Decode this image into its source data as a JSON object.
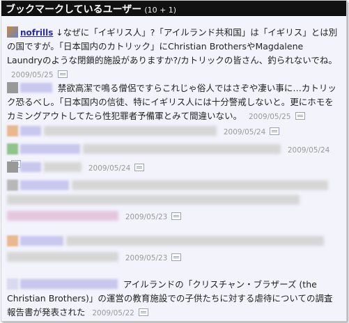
{
  "header": {
    "title": "ブックマークしているユーザー",
    "count": "(10 + 1)"
  },
  "entries": [
    {
      "user": "nofrills",
      "comment": "↓なぜに「イギリス人」?「アイルランド共和国」は「イギリス」とは別の国ですが。「日本国内のカトリック」にChristian BrothersやMagdalene Laundryのような閉鎖的施設がありますか?/カトリックの皆さん、釣られないでね。",
      "date": "2009/05/25"
    },
    {
      "comment": "禁欲高潔で鳴る僧侶ですらこれじゃ俗人ではさぞや凄い事に…カトリック恐るべし。「日本国内の信徒、特にイギリス人には十分警戒しないと。更にホモをカミングアウトしてたら性犯罪者予備軍とみて間違いない。",
      "date": "2009/05/25"
    },
    {
      "date": "2009/05/24"
    },
    {
      "date": "2009/05/24"
    },
    {
      "date": "2009/05/24"
    },
    {
      "date": "2009/05/23"
    },
    {
      "date": "2009/05/23"
    },
    {
      "comment": "アイルランドの「クリスチャン・ブラザーズ (the Christian Brothers)」の運営の教育施設での子供たちに対する虐待についての調査報告書が発表された",
      "date": "2009/05/22"
    }
  ]
}
